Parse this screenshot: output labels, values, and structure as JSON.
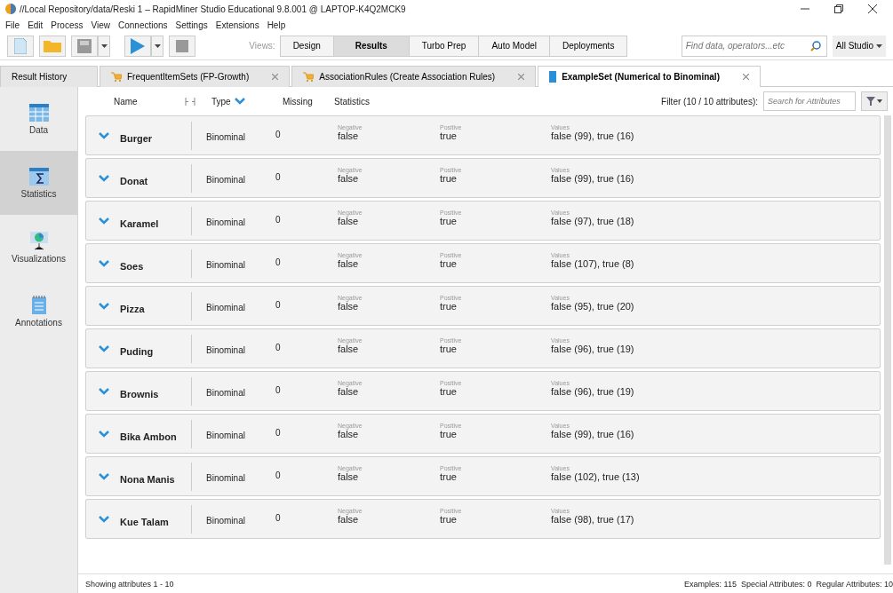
{
  "window": {
    "title": "//Local Repository/data/Reski 1 – RapidMiner Studio Educational 9.8.001 @ LAPTOP-K4Q2MCK9"
  },
  "menu": [
    "File",
    "Edit",
    "Process",
    "View",
    "Connections",
    "Settings",
    "Extensions",
    "Help"
  ],
  "toolbar": {
    "views_label": "Views:",
    "views": [
      {
        "label": "Design",
        "selected": false
      },
      {
        "label": "Results",
        "selected": true
      },
      {
        "label": "Turbo Prep",
        "selected": false
      },
      {
        "label": "Auto Model",
        "selected": false
      },
      {
        "label": "Deployments",
        "selected": false
      }
    ],
    "search": {
      "placeholder": "Find data, operators...etc"
    },
    "scope": "All Studio"
  },
  "tabs": [
    {
      "label": "Result History",
      "selected": false
    },
    {
      "label": "FrequentItemSets (FP-Growth)",
      "selected": false
    },
    {
      "label": "AssociationRules (Create Association Rules)",
      "selected": false
    },
    {
      "label": "ExampleSet (Numerical to Binominal)",
      "selected": true
    }
  ],
  "sidebar": [
    {
      "label": "Data",
      "selected": false
    },
    {
      "label": "Statistics",
      "selected": true
    },
    {
      "label": "Visualizations",
      "selected": false
    },
    {
      "label": "Annotations",
      "selected": false
    }
  ],
  "columns": [
    "Name",
    "Type",
    "Missing",
    "Statistics"
  ],
  "filter": {
    "label": "Filter (10 / 10 attributes):",
    "placeholder": "Search for Attributes"
  },
  "rows": [
    {
      "name": "Burger",
      "type": "Binominal",
      "missing": "0",
      "negative_label": "Negative",
      "negative": "false",
      "positive_label": "Positive",
      "positive": "true",
      "values_label": "Values",
      "values": "false (99), true (16)"
    },
    {
      "name": "Donat",
      "type": "Binominal",
      "missing": "0",
      "negative_label": "Negative",
      "negative": "false",
      "positive_label": "Positive",
      "positive": "true",
      "values_label": "Values",
      "values": "false (99), true (16)"
    },
    {
      "name": "Karamel",
      "type": "Binominal",
      "missing": "0",
      "negative_label": "Negative",
      "negative": "false",
      "positive_label": "Positive",
      "positive": "true",
      "values_label": "Values",
      "values": "false (97), true (18)"
    },
    {
      "name": "Soes",
      "type": "Binominal",
      "missing": "0",
      "negative_label": "Negative",
      "negative": "false",
      "positive_label": "Positive",
      "positive": "true",
      "values_label": "Values",
      "values": "false (107), true (8)"
    },
    {
      "name": "Pizza",
      "type": "Binominal",
      "missing": "0",
      "negative_label": "Negative",
      "negative": "false",
      "positive_label": "Positive",
      "positive": "true",
      "values_label": "Values",
      "values": "false (95), true (20)"
    },
    {
      "name": "Puding",
      "type": "Binominal",
      "missing": "0",
      "negative_label": "Negative",
      "negative": "false",
      "positive_label": "Positive",
      "positive": "true",
      "values_label": "Values",
      "values": "false (96), true (19)"
    },
    {
      "name": "Brownis",
      "type": "Binominal",
      "missing": "0",
      "negative_label": "Negative",
      "negative": "false",
      "positive_label": "Positive",
      "positive": "true",
      "values_label": "Values",
      "values": "false (96), true (19)"
    },
    {
      "name": "Bika Ambon",
      "type": "Binominal",
      "missing": "0",
      "negative_label": "Negative",
      "negative": "false",
      "positive_label": "Positive",
      "positive": "true",
      "values_label": "Values",
      "values": "false (99), true (16)"
    },
    {
      "name": "Nona Manis",
      "type": "Binominal",
      "missing": "0",
      "negative_label": "Negative",
      "negative": "false",
      "positive_label": "Positive",
      "positive": "true",
      "values_label": "Values",
      "values": "false (102), true (13)"
    },
    {
      "name": "Kue Talam",
      "type": "Binominal",
      "missing": "0",
      "negative_label": "Negative",
      "negative": "false",
      "positive_label": "Positive",
      "positive": "true",
      "values_label": "Values",
      "values": "false (98), true (17)"
    }
  ],
  "footer": {
    "left": "Showing attributes 1 - 10",
    "right": "Examples: 115  Special Attributes: 0  Regular Attributes: 10"
  }
}
